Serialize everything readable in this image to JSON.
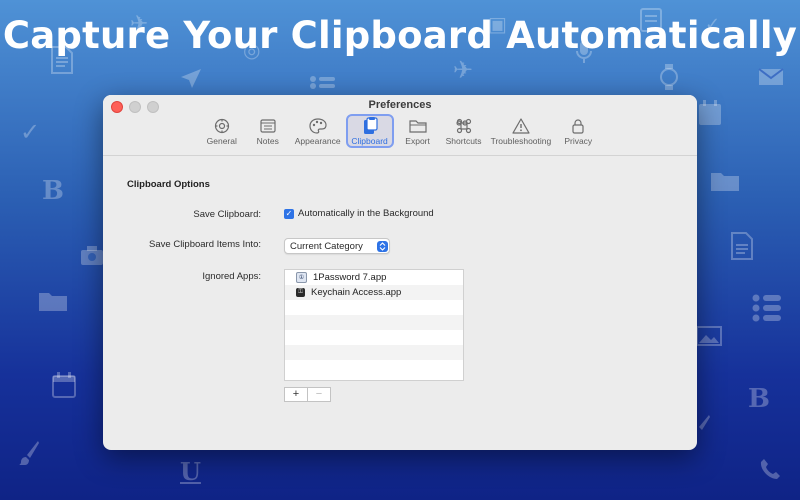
{
  "headline": "Capture Your Clipboard Automatically",
  "background_icons": [
    "document-icon",
    "airplane-icon",
    "calendar-icon",
    "location-arrow-icon",
    "list-icon",
    "checkmark-icon",
    "bold-b-icon",
    "camera-icon",
    "folder-icon",
    "brush-icon",
    "underline-u-icon",
    "envelope-icon",
    "watch-icon",
    "image-icon",
    "phone-icon",
    "microphone-icon",
    "globe-icon"
  ],
  "window": {
    "title": "Preferences",
    "tabs": [
      {
        "label": "General",
        "icon": "gear-icon"
      },
      {
        "label": "Notes",
        "icon": "note-icon"
      },
      {
        "label": "Appearance",
        "icon": "palette-icon"
      },
      {
        "label": "Clipboard",
        "icon": "clipboard-icon",
        "active": true
      },
      {
        "label": "Export",
        "icon": "folder-icon"
      },
      {
        "label": "Shortcuts",
        "icon": "command-icon"
      },
      {
        "label": "Troubleshooting",
        "icon": "warning-icon"
      },
      {
        "label": "Privacy",
        "icon": "lock-icon"
      }
    ]
  },
  "clipboard": {
    "section_title": "Clipboard Options",
    "save_clipboard_label": "Save Clipboard:",
    "save_clipboard_option": "Automatically in the Background",
    "save_clipboard_checked": true,
    "save_into_label": "Save Clipboard Items Into:",
    "save_into_value": "Current Category",
    "ignored_apps_label": "Ignored Apps:",
    "ignored_apps": [
      "1Password 7.app",
      "Keychain Access.app"
    ],
    "add_label": "+",
    "remove_label": "−"
  },
  "colors": {
    "accent": "#2e73e6",
    "close": "#fe5f57"
  }
}
